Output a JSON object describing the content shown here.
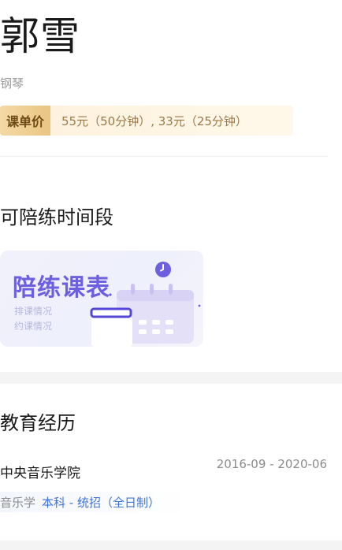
{
  "teacher": {
    "name": "郭雪",
    "instrument": "钢琴",
    "price_label": "课单价",
    "price_text": "55元（50分钟）, 33元（25分钟）"
  },
  "slots": {
    "title": "可陪练时间段",
    "schedule_card": {
      "title": "陪练课表",
      "line1": "排课情况",
      "line2": "约课情况",
      "accent_color": "#6c5fe0",
      "icons": [
        "clock-icon",
        "calendar-icon"
      ]
    }
  },
  "education": {
    "title": "教育经历",
    "items": [
      {
        "school": "中央音乐学院",
        "dates": "2016-09 - 2020-06",
        "major": "音乐学",
        "degree": "本科 - 统招（全日制）"
      }
    ]
  },
  "colors": {
    "price_tag_bg": "#e9c584",
    "degree_blue": "#3f74d6",
    "page_bg": "#f4f4f4"
  }
}
